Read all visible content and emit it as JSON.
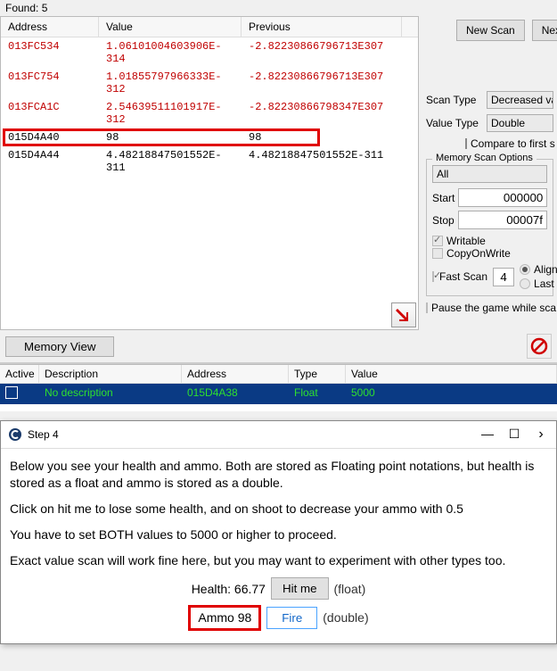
{
  "found_label": "Found: 5",
  "columns": {
    "address": "Address",
    "value": "Value",
    "previous": "Previous"
  },
  "rows": [
    {
      "addr": "013FC534",
      "val": "1.06101004603906E-314",
      "prev": "-2.82230866796713E307",
      "red": true
    },
    {
      "addr": "013FC754",
      "val": "1.01855797966333E-312",
      "prev": "-2.82230866796713E307",
      "red": true
    },
    {
      "addr": "013FCA1C",
      "val": "2.54639511101917E-312",
      "prev": "-2.82230866798347E307",
      "red": true
    },
    {
      "addr": "015D4A40",
      "val": "98",
      "prev": "98",
      "red": false,
      "highlight": true
    },
    {
      "addr": "015D4A44",
      "val": "4.48218847501552E-311",
      "prev": "4.48218847501552E-311",
      "red": false
    }
  ],
  "buttons": {
    "new_scan": "New Scan",
    "next_scan": "Next Scan",
    "memory_view": "Memory View"
  },
  "scan_type_label": "Scan Type",
  "scan_type_value": "Decreased value",
  "value_type_label": "Value Type",
  "value_type_value": "Double",
  "compare_first": "Compare to first s",
  "mem_scan_options": "Memory Scan Options",
  "mem_all": "All",
  "start_label": "Start",
  "start_value": "000000",
  "stop_label": "Stop",
  "stop_value": "00007f",
  "writable": "Writable",
  "copyonwrite": "CopyOnWrite",
  "fastscan": "Fast Scan",
  "fastscan_val": "4",
  "align": "Align",
  "lastd": "Last l",
  "pause": "Pause the game while sca",
  "addr_table": {
    "headers": {
      "active": "Active",
      "desc": "Description",
      "addr": "Address",
      "type": "Type",
      "value": "Value"
    },
    "row": {
      "desc": "No description",
      "addr": "015D4A38",
      "type": "Float",
      "value": "5000"
    }
  },
  "tutorial": {
    "title": "Step 4",
    "body1": "Below you see your health and ammo. Both are stored as Floating point notations, but health is stored as a float and ammo is stored as a double.",
    "body2": "Click on hit me to lose some health, and on shoot to decrease your ammo with 0.5",
    "body3": "You have to set BOTH values to 5000 or higher to proceed.",
    "body4": "Exact value scan will work fine here, but you may want to experiment with other types too.",
    "health_label": "Health: 66.77",
    "hitme": "Hit me",
    "float_note": "(float)",
    "ammo_label": "Ammo 98",
    "fire": "Fire",
    "double_note": "(double)"
  }
}
